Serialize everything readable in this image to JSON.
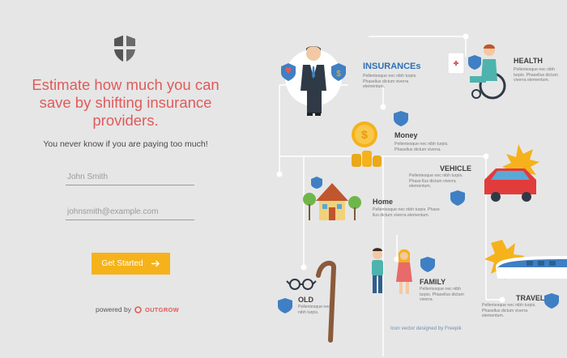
{
  "hero": {
    "logo_icon": "shield-icon",
    "headline": "Estimate how much you can save by shifting insurance providers.",
    "subline": "You never know if you are paying too much!"
  },
  "form": {
    "name_placeholder": "John Smith",
    "email_placeholder": "johnsmith@example.com",
    "cta_label": "Get Started",
    "cta_icon": "arrow-right-icon",
    "cta_color": "#f5b21b"
  },
  "footer": {
    "powered_by": "powered by",
    "brand": "OUTGROW"
  },
  "colors": {
    "accent": "#e05a5a",
    "shield_blue": "#3f7fc4"
  },
  "infographic": {
    "insurance": {
      "title": "INSURANCEs",
      "text": "Pellentesque nec nibh turpis. Phasellus dictum viverra elementum."
    },
    "health": {
      "title": "HEALTH",
      "text": "Pellentesque nec nibh turpis. Phasellus dictum viverra elementum."
    },
    "money": {
      "title": "Money",
      "text": "Pellentesque nec nibh turpis. Phasellus dictum viverra."
    },
    "vehicle": {
      "title": "VEHICLE",
      "text": "Pellentesque nec nibh turpis. Phase llus dictum viverra elementum."
    },
    "home": {
      "title": "Home",
      "text": "Pellentesque nec nibh turpis. Phase llus dictum viverra elementum."
    },
    "family": {
      "title": "FAMILY",
      "text": "Pellentesque nec nibh turpis. Phasellus dictum viverra."
    },
    "old": {
      "title": "OLD",
      "text": "Pellentesque nec nibh turpis."
    },
    "travel": {
      "title": "TRAVEL",
      "text": "Pellentesque nec nibh turpis. Phasellus dictum viverra elementum."
    },
    "credit": "Icon vector designed by Freepik"
  }
}
